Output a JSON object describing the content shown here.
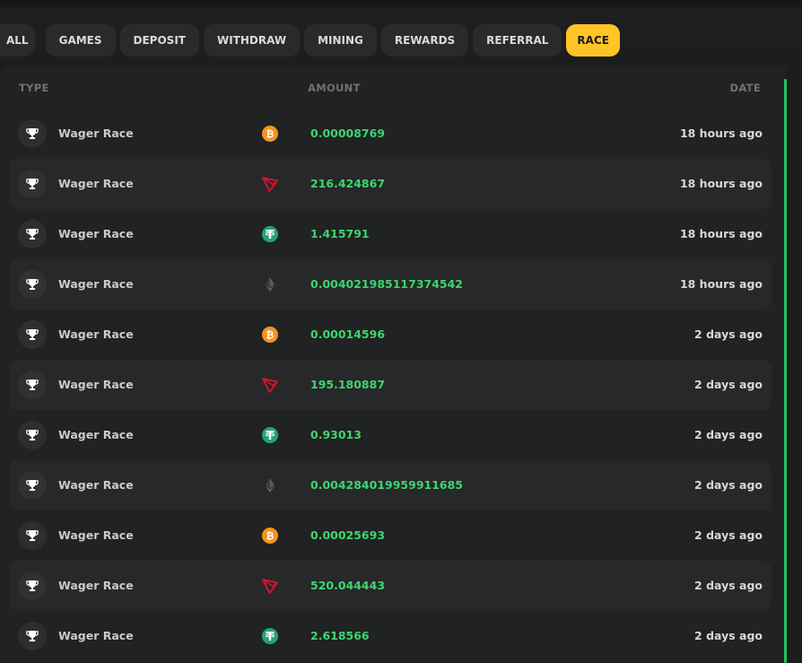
{
  "tabs": [
    {
      "label": "ALL",
      "active": false
    },
    {
      "label": "GAMES",
      "active": false
    },
    {
      "label": "DEPOSIT",
      "active": false
    },
    {
      "label": "WITHDRAW",
      "active": false
    },
    {
      "label": "MINING",
      "active": false
    },
    {
      "label": "REWARDS",
      "active": false
    },
    {
      "label": "REFERRAL",
      "active": false
    },
    {
      "label": "RACE",
      "active": true
    }
  ],
  "table": {
    "headers": {
      "type": "TYPE",
      "amount": "AMOUNT",
      "date": "DATE"
    },
    "rows": [
      {
        "type": "Wager Race",
        "currency_icon": "bitcoin-icon",
        "amount": "0.00008769",
        "date": "18 hours ago"
      },
      {
        "type": "Wager Race",
        "currency_icon": "tron-icon",
        "amount": "216.424867",
        "date": "18 hours ago"
      },
      {
        "type": "Wager Race",
        "currency_icon": "tether-icon",
        "amount": "1.415791",
        "date": "18 hours ago"
      },
      {
        "type": "Wager Race",
        "currency_icon": "ethereum-icon",
        "amount": "0.004021985117374542",
        "date": "18 hours ago"
      },
      {
        "type": "Wager Race",
        "currency_icon": "bitcoin-icon",
        "amount": "0.00014596",
        "date": "2 days ago"
      },
      {
        "type": "Wager Race",
        "currency_icon": "tron-icon",
        "amount": "195.180887",
        "date": "2 days ago"
      },
      {
        "type": "Wager Race",
        "currency_icon": "tether-icon",
        "amount": "0.93013",
        "date": "2 days ago"
      },
      {
        "type": "Wager Race",
        "currency_icon": "ethereum-icon",
        "amount": "0.004284019959911685",
        "date": "2 days ago"
      },
      {
        "type": "Wager Race",
        "currency_icon": "bitcoin-icon",
        "amount": "0.00025693",
        "date": "2 days ago"
      },
      {
        "type": "Wager Race",
        "currency_icon": "tron-icon",
        "amount": "520.044443",
        "date": "2 days ago"
      },
      {
        "type": "Wager Race",
        "currency_icon": "tether-icon",
        "amount": "2.618566",
        "date": "2 days ago"
      }
    ]
  },
  "colors": {
    "active_tab": "#ffc425",
    "amount_positive": "#3fd56d",
    "scroll_accent": "#23c55e",
    "bitcoin": "#f7931a",
    "tron": "#e0102c",
    "tether": "#26a17b",
    "ethereum": "#5a5d60"
  }
}
